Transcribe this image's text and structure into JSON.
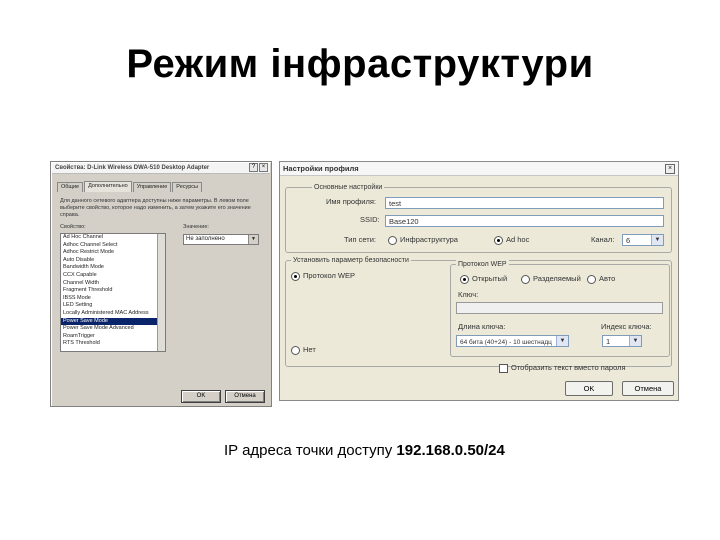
{
  "slide": {
    "title": "Режим інфраструктури",
    "caption_prefix": "IP адреса точки доступу ",
    "caption_value": "192.168.0.50/24"
  },
  "left_dialog": {
    "title": "Свойства: D-Link Wireless DWA-510 Desktop Adapter",
    "tabs": [
      "Общие",
      "Дополнительно",
      "Управление",
      "Ресурсы"
    ],
    "description": "Для данного сетевого адаптера доступны ниже параметры. В левом поле выберите свойство, которое надо изменить, а затем укажите его значение справа.",
    "property_label": "Свойство:",
    "value_label": "Значение:",
    "properties": [
      "Ad Hoc Channel",
      "Adhoc Channel Select",
      "Adhoc Restrict Mode",
      "Auto Disable",
      "Bandwidth Mode",
      "CCX Capable",
      "Channel Width",
      "Fragment Threshold",
      "IBSS Mode",
      "LED Setting",
      "Locally Administered MAC Address",
      "Power Save Mode",
      "Power Save Mode Advanced",
      "RoamTrigger",
      "RTS Threshold"
    ],
    "selected_index": 11,
    "value": "Не заполнено",
    "ok_label": "OK",
    "cancel_label": "Отмена"
  },
  "right_dialog": {
    "title": "Настройки профиля",
    "general_group": "Основные настройки",
    "profile_name_label": "Имя профиля:",
    "profile_name_value": "test",
    "ssid_label": "SSID:",
    "ssid_value": "Base120",
    "net_type_label": "Тип сети:",
    "infra_label": "Инфраструктура",
    "adhoc_label": "Ad hoc",
    "channel_label": "Канал:",
    "channel_value": "6",
    "security_group": "Установить параметр безопасности",
    "wep_label": "Протокол WEP",
    "none_label": "Нет",
    "wep_group": "Протокол WEP",
    "open_label": "Открытый",
    "shared_label": "Разделяемый",
    "auto_label": "Авто",
    "key_label": "Ключ:",
    "key_length_label": "Длина ключа:",
    "key_length_value": "64 бита (40+24) - 10 шестнадц",
    "key_index_label": "Индекс ключа:",
    "key_index_value": "1",
    "show_password_label": "Отобразить текст вместо пароля",
    "ok_label": "OK",
    "cancel_label": "Отмена"
  }
}
